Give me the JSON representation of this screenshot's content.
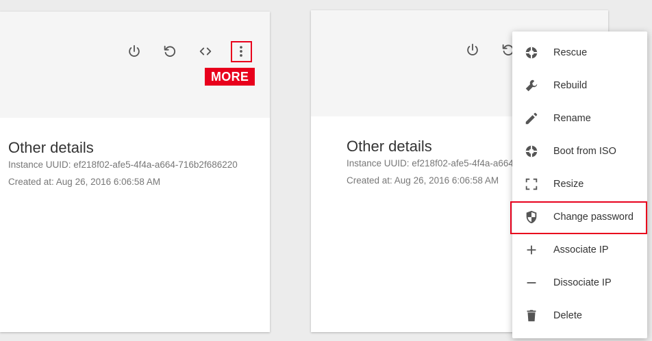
{
  "left_card": {
    "more_badge": "MORE",
    "details_title": "Other details",
    "uuid_line": "Instance UUID: ef218f02-afe5-4f4a-a664-716b2f686220",
    "created_line": "Created at: Aug 26, 2016 6:06:58 AM"
  },
  "right_card": {
    "details_title": "Other details",
    "uuid_line": "Instance UUID: ef218f02-afe5-4f4a-a664-716b2f686220",
    "created_line": "Created at: Aug 26, 2016 6:06:58 AM"
  },
  "menu": {
    "items": [
      {
        "label": "Rescue",
        "icon": "lifebuoy-icon"
      },
      {
        "label": "Rebuild",
        "icon": "wrench-icon"
      },
      {
        "label": "Rename",
        "icon": "pencil-icon"
      },
      {
        "label": "Boot from ISO",
        "icon": "disc-icon"
      },
      {
        "label": "Resize",
        "icon": "resize-icon"
      },
      {
        "label": "Change password",
        "icon": "shield-icon"
      },
      {
        "label": "Associate IP",
        "icon": "plus-icon"
      },
      {
        "label": "Dissociate IP",
        "icon": "minus-icon"
      },
      {
        "label": "Delete",
        "icon": "trash-icon"
      }
    ]
  },
  "colors": {
    "accent_red": "#e8001c",
    "icon_gray": "#555555",
    "header_bg": "#f5f5f5"
  }
}
